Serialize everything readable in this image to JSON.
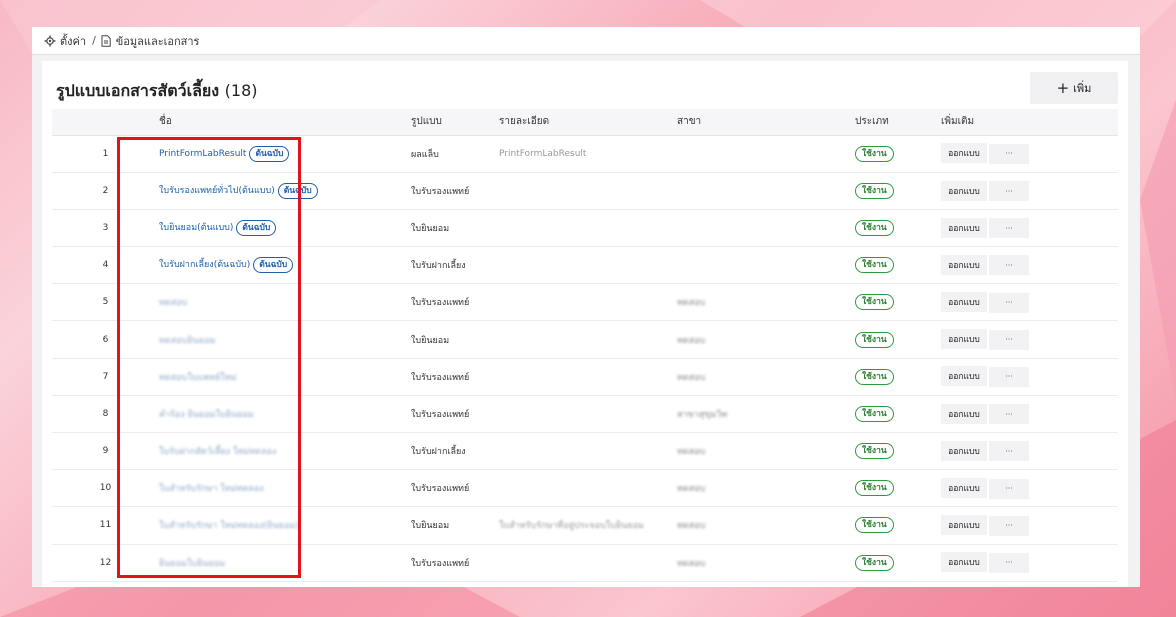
{
  "breadcrumb": {
    "settings_label": "ตั้งค่า",
    "separator": "/",
    "page_label": "ข้อมูลและเอกสาร"
  },
  "card": {
    "title": "รูปแบบเอกสารสัตว์เลี้ยง",
    "count": "(18)",
    "add_label": "เพิ่ม"
  },
  "table": {
    "headers": {
      "name": "ชื่อ",
      "format": "รูปแบบ",
      "detail": "รายละเอียด",
      "branch": "สาขา",
      "type": "ประเภท",
      "more": "เพิ่มเติม"
    },
    "original_label": "ต้นฉบับ",
    "status_label": "ใช้งาน",
    "design_label": "ออกแบบ",
    "more_label": "···",
    "rows": [
      {
        "num": "1",
        "name": "PrintFormLabResult",
        "original": true,
        "format": "ผลแล็บ",
        "detail": "PrintFormLabResult",
        "branch": ""
      },
      {
        "num": "2",
        "name": "ใบรับรองแพทย์ทั่วไป(ต้นแบบ)",
        "original": true,
        "format": "ใบรับรองแพทย์",
        "detail": "",
        "branch": ""
      },
      {
        "num": "3",
        "name": "ใบยินยอม(ต้นแบบ)",
        "original": true,
        "format": "ใบยินยอม",
        "detail": "",
        "branch": ""
      },
      {
        "num": "4",
        "name": "ใบรับฝากเลี้ยง(ต้นฉบับ)",
        "original": true,
        "format": "ใบรับฝากเลี้ยง",
        "detail": "",
        "branch": ""
      },
      {
        "num": "5",
        "name": "ทดสอบ",
        "original": false,
        "format": "ใบรับรองแพทย์",
        "detail": "",
        "branch": "ทดสอบ"
      },
      {
        "num": "6",
        "name": "ทดสอบยินยอม",
        "original": false,
        "format": "ใบยินยอม",
        "detail": "",
        "branch": "ทดสอบ"
      },
      {
        "num": "7",
        "name": "ทดสอบใบแพทย์ใหม่",
        "original": false,
        "format": "ใบรับรองแพทย์",
        "detail": "",
        "branch": "ทดสอบ"
      },
      {
        "num": "8",
        "name": "คำร้อง ยินยอมใบยินยอม",
        "original": false,
        "format": "ใบรับรองแพทย์",
        "detail": "",
        "branch": "สาขาสุขุมวิท"
      },
      {
        "num": "9",
        "name": "ใบรับฝากสัตว์เลี้ยง ใหม่ทดลอง",
        "original": false,
        "format": "ใบรับฝากเลี้ยง",
        "detail": "",
        "branch": "ทดสอบ"
      },
      {
        "num": "10",
        "name": "ใบสำหรับรักษา ใหม่ทดลอง",
        "original": false,
        "format": "ใบรับรองแพทย์",
        "detail": "",
        "branch": "ทดสอบ"
      },
      {
        "num": "11",
        "name": "ใบสำหรับรักษา ใหม่ทดลอง(ยินยอม)",
        "original": false,
        "format": "ใบยินยอม",
        "detail": "ใบสำหรับรักษาที่อยู่ประจอบใบยินยอม",
        "branch": "ทดสอบ"
      },
      {
        "num": "12",
        "name": "ยินยอมใบยินยอม",
        "original": false,
        "format": "ใบรับรองแพทย์",
        "detail": "",
        "branch": "ทดสอบ"
      }
    ]
  },
  "colors": {
    "link": "#1f5fa8",
    "status_green": "#2a9d3a",
    "highlight_red": "#e3121c"
  }
}
